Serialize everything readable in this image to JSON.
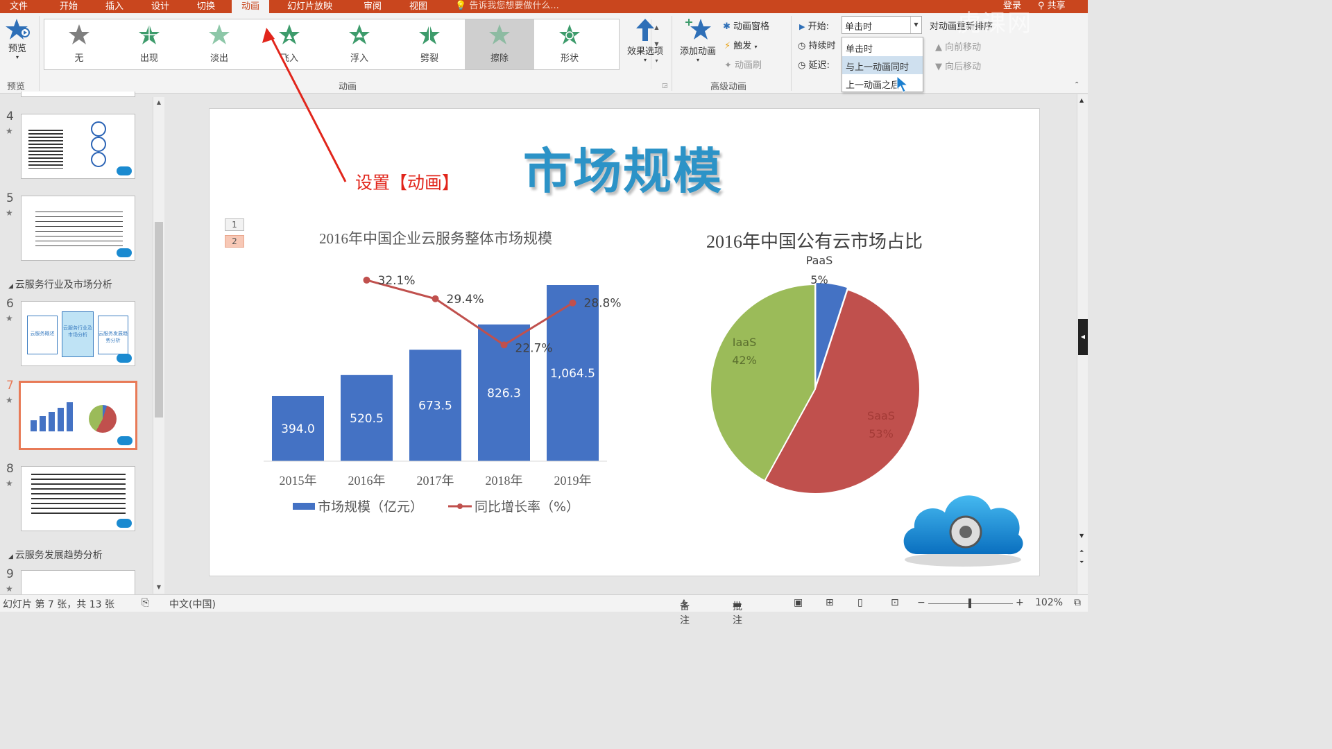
{
  "menubar": {
    "tabs": [
      "文件",
      "开始",
      "插入",
      "设计",
      "切换",
      "动画",
      "幻灯片放映",
      "审阅",
      "视图"
    ],
    "active": "动画",
    "tellme": "告诉我您想要做什么...",
    "login": "登录",
    "share": "共享"
  },
  "ribbon": {
    "preview_label": "预览",
    "preview_group": "预览",
    "animation_group": "动画",
    "advanced_group": "高级动画",
    "effects": [
      "无",
      "出现",
      "淡出",
      "飞入",
      "浮入",
      "劈裂",
      "擦除",
      "形状"
    ],
    "selected_effect": "擦除",
    "effect_options": "效果选项",
    "add_animation": "添加动画",
    "animation_pane": "动画窗格",
    "trigger": "触发",
    "painter": "动画刷",
    "start_label": "开始:",
    "start_value": "单击时",
    "duration_label": "持续时",
    "delay_label": "延迟:",
    "reorder": "对动画重新排序",
    "move_earlier": "向前移动",
    "move_later": "向后移动",
    "dropdown": [
      "单击时",
      "与上一动画同时",
      "上一动画之后"
    ],
    "dropdown_highlight": "与上一动画同时"
  },
  "watermark": "虎课网",
  "thumbnails": {
    "slides": [
      {
        "num": "4",
        "star": "★"
      },
      {
        "num": "5",
        "star": "★"
      },
      {
        "num": "6",
        "star": "★"
      },
      {
        "num": "7",
        "star": "★"
      },
      {
        "num": "8",
        "star": "★"
      },
      {
        "num": "9",
        "star": "★"
      }
    ],
    "sections": [
      "云服务行业及市场分析",
      "云服务发展趋势分析"
    ],
    "slide6_boxes": [
      "云服务概述",
      "云服务行业及市场分析",
      "云服务发展趋势分析"
    ]
  },
  "slide": {
    "title": "市场规模",
    "annotation": "设置【动画】",
    "anim_tags": [
      "1",
      "2"
    ]
  },
  "chart_data": [
    {
      "type": "bar",
      "title": "2016年中国企业云服务整体市场规模",
      "categories": [
        "2015年",
        "2016年",
        "2017年",
        "2018年",
        "2019年"
      ],
      "series": [
        {
          "name": "市场规模（亿元）",
          "type": "bar",
          "values": [
            394.0,
            520.5,
            673.5,
            826.3,
            1064.5
          ],
          "labels": [
            "394.0",
            "520.5",
            "673.5",
            "826.3",
            "1,064.5"
          ],
          "color": "#4472c4"
        },
        {
          "name": "同比增长率（%）",
          "type": "line",
          "values": [
            null,
            32.1,
            29.4,
            22.7,
            28.8
          ],
          "labels": [
            "",
            "32.1%",
            "29.4%",
            "22.7%",
            "28.8%"
          ],
          "color": "#c0504d"
        }
      ],
      "legend": "bottom"
    },
    {
      "type": "pie",
      "title": "2016年中国公有云市场占比",
      "labels": [
        "PaaS",
        "SaaS",
        "IaaS"
      ],
      "values": [
        5,
        53,
        42
      ],
      "value_labels": [
        "5%",
        "53%",
        "42%"
      ],
      "colors": [
        "#4472c4",
        "#c0504d",
        "#9bbb59"
      ]
    }
  ],
  "status": {
    "slide_info": "幻灯片 第 7 张，共 13 张",
    "language": "中文(中国)",
    "notes": "备注",
    "comments": "批注",
    "zoom": "102%"
  }
}
